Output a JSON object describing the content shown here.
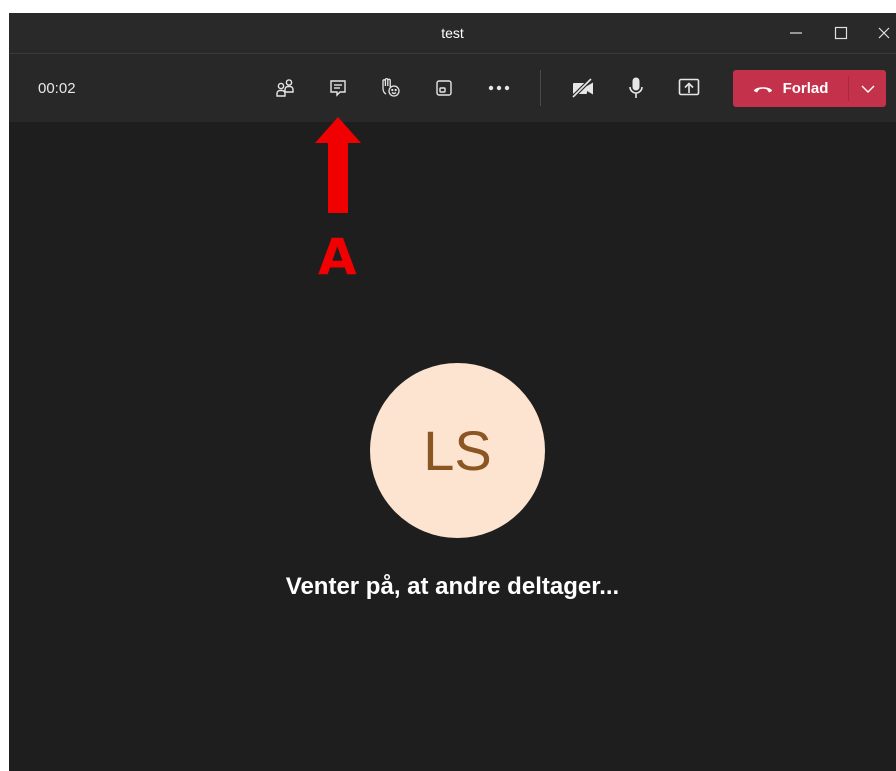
{
  "window": {
    "title": "test"
  },
  "toolbar": {
    "timer": "00:02",
    "icons": {
      "participants": "people-icon",
      "chat": "chat-icon",
      "raise_hand": "raise-hand-icon",
      "rooms": "breakout-rooms-icon",
      "more": "more-icon",
      "camera": "camera-off-icon",
      "mic": "microphone-icon",
      "share": "share-screen-icon"
    },
    "leave_label": "Forlad"
  },
  "annotation": {
    "label": "A",
    "color": "#f00000"
  },
  "participant": {
    "initials": "LS",
    "avatar_bg": "#fce4d1",
    "avatar_fg": "#8c5524"
  },
  "status": {
    "waiting_text": "Venter på, at andre deltager..."
  },
  "colors": {
    "leave_button": "#c4314b",
    "background": "#1f1e1f"
  }
}
